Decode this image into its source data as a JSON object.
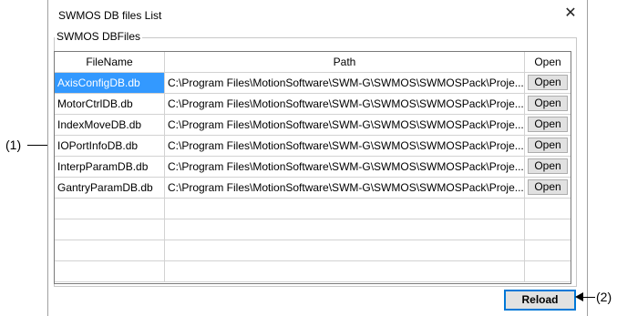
{
  "window": {
    "title": "SWMOS DB files List",
    "close_glyph": "✕"
  },
  "group": {
    "label": "SWMOS DBFiles"
  },
  "table": {
    "headers": {
      "name": "FileName",
      "path": "Path",
      "open": "Open"
    },
    "rows": [
      {
        "name": "AxisConfigDB.db",
        "path": "C:\\Program Files\\MotionSoftware\\SWM-G\\SWMOS\\SWMOSPack\\Proje...",
        "open": "Open",
        "selected": true
      },
      {
        "name": "MotorCtrlDB.db",
        "path": "C:\\Program Files\\MotionSoftware\\SWM-G\\SWMOS\\SWMOSPack\\Proje...",
        "open": "Open"
      },
      {
        "name": "IndexMoveDB.db",
        "path": "C:\\Program Files\\MotionSoftware\\SWM-G\\SWMOS\\SWMOSPack\\Proje...",
        "open": "Open"
      },
      {
        "name": "IOPortInfoDB.db",
        "path": "C:\\Program Files\\MotionSoftware\\SWM-G\\SWMOS\\SWMOSPack\\Proje...",
        "open": "Open"
      },
      {
        "name": "InterpParamDB.db",
        "path": "C:\\Program Files\\MotionSoftware\\SWM-G\\SWMOS\\SWMOSPack\\Proje...",
        "open": "Open"
      },
      {
        "name": "GantryParamDB.db",
        "path": "C:\\Program Files\\MotionSoftware\\SWM-G\\SWMOS\\SWMOSPack\\Proje...",
        "open": "Open"
      }
    ],
    "empty_rows": 4
  },
  "reload_button": {
    "label": "Reload"
  },
  "callouts": {
    "one": "(1)",
    "two": "(2)"
  },
  "colors": {
    "selection": "#3399ff",
    "focus_border": "#0078d7"
  }
}
